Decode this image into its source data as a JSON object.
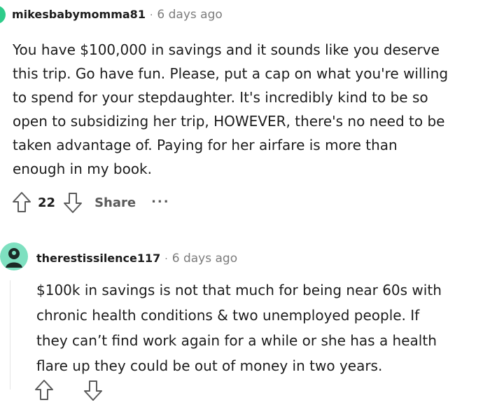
{
  "comments": [
    {
      "username": "mikesbabymomma81",
      "time": "6 days ago",
      "body_lines": [
        "You have $100,000 in savings and it sounds like you deserve",
        "this trip. Go have fun. Please, put a cap on what you're willing",
        "to spend for your stepdaughter. It's incredibly kind to be so",
        "open to subsidizing her trip, HOWEVER, there's no need to be",
        "taken advantage of. Paying for her airfare is more than",
        "enough in my book."
      ],
      "score": "22",
      "share_label": "Share",
      "more_label": "..."
    },
    {
      "username": "therestissilence117",
      "time": "6 days ago",
      "body_lines": [
        "$100k in savings is not that much for being near 60s with",
        "chronic health conditions & two unemployed people. If",
        "they can’t find work again for a while or she has a health",
        "flare up they could be out of money in two years."
      ]
    }
  ],
  "separator": "·",
  "colors": {
    "accent_green": "#2ecc8a",
    "meta_gray": "#7c7c7c",
    "text": "#1c1c1c"
  },
  "icons": [
    "upvote-icon",
    "downvote-icon",
    "avatar-icon"
  ]
}
